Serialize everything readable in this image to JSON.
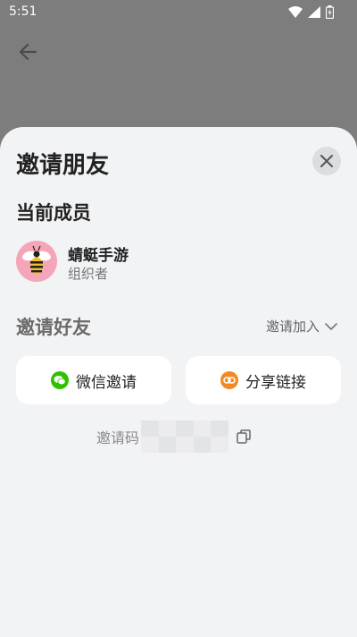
{
  "status_bar": {
    "time": "5:51",
    "icons": [
      "wifi-icon",
      "signal-icon",
      "battery-icon"
    ]
  },
  "sheet": {
    "title": "邀请朋友",
    "members_section": {
      "title": "当前成员",
      "members": [
        {
          "name": "蜻蜓手游",
          "role": "组织者",
          "avatar_icon": "bee-avatar"
        }
      ]
    },
    "invite_section": {
      "title": "邀请好友",
      "join_dropdown_label": "邀请加入",
      "wechat_invite_label": "微信邀请",
      "share_link_label": "分享链接",
      "invite_code_label": "邀请码"
    }
  },
  "colors": {
    "wechat_green": "#2dc100",
    "share_orange": "#f08a24",
    "sheet_bg": "#f2f3f5",
    "overlay": "#7d7d7d"
  }
}
